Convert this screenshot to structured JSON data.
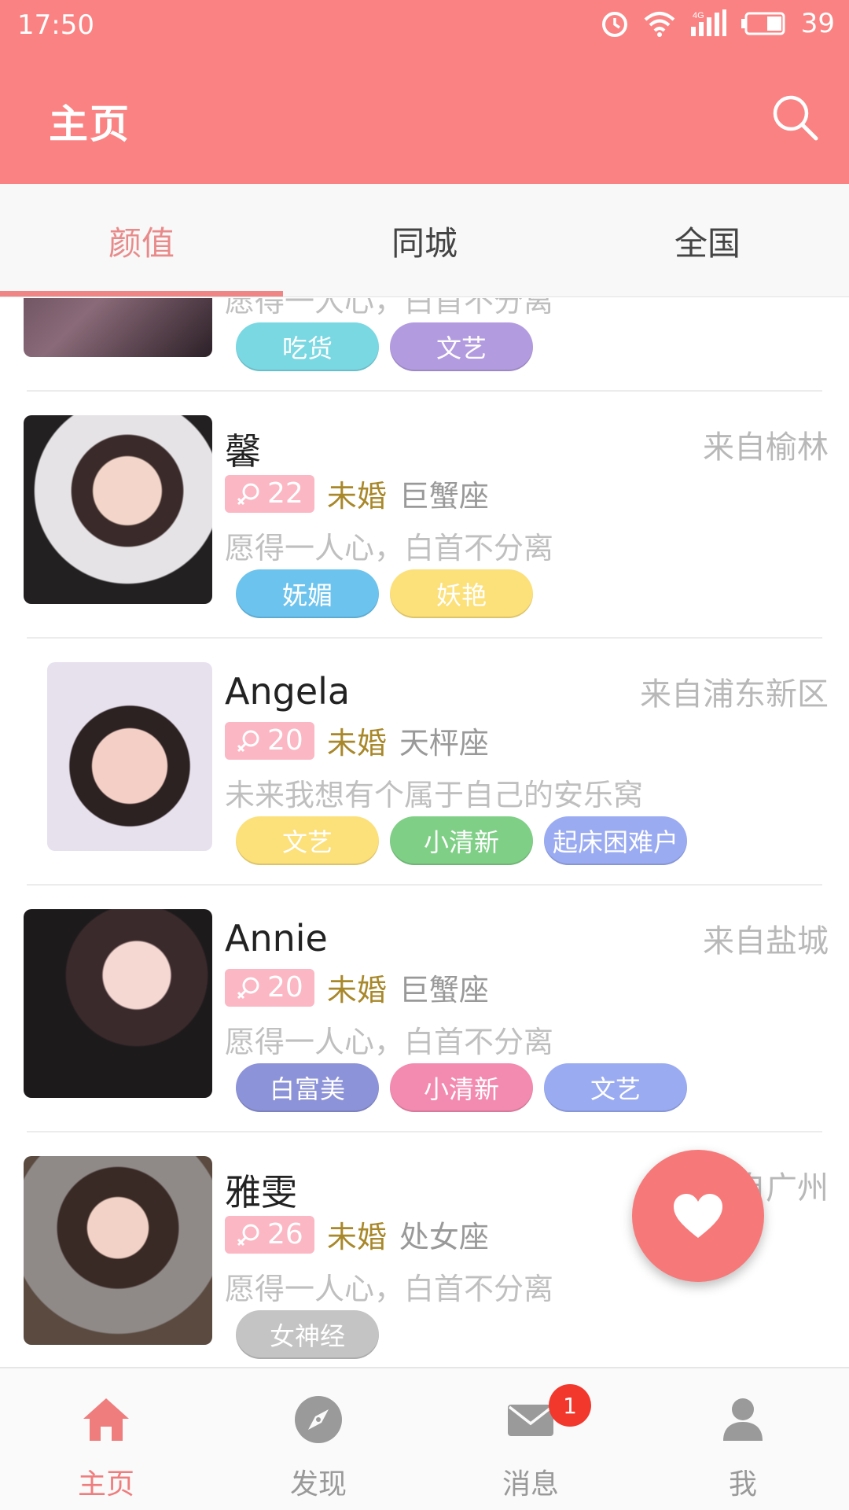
{
  "status_bar": {
    "time": "17:50",
    "network": "4G",
    "battery": "39"
  },
  "app_bar": {
    "title": "主页",
    "search_icon": "search-icon"
  },
  "tabs": [
    {
      "label": "颜值",
      "active": true
    },
    {
      "label": "同城",
      "active": false
    },
    {
      "label": "全国",
      "active": false
    }
  ],
  "profiles": [
    {
      "name": "",
      "from": "",
      "age": "",
      "marital": "",
      "zodiac": "",
      "motto": "愿得一人心，白首不分离",
      "tags": [
        {
          "label": "吃货",
          "color": "#7ad8e3"
        },
        {
          "label": "文艺",
          "color": "#b39be0"
        }
      ]
    },
    {
      "name": "馨",
      "from": "来自榆林",
      "age": "22",
      "marital": "未婚",
      "zodiac": "巨蟹座",
      "motto": "愿得一人心，白首不分离",
      "tags": [
        {
          "label": "妩媚",
          "color": "#6cc3ee"
        },
        {
          "label": "妖艳",
          "color": "#fce07a"
        }
      ]
    },
    {
      "name": "Angela",
      "from": "来自浦东新区",
      "age": "20",
      "marital": "未婚",
      "zodiac": "天枰座",
      "motto": "未来我想有个属于自己的安乐窝",
      "tags": [
        {
          "label": "文艺",
          "color": "#fce07a"
        },
        {
          "label": "小清新",
          "color": "#7fcf86"
        },
        {
          "label": "起床困难户",
          "color": "#9aabf2"
        }
      ]
    },
    {
      "name": "Annie",
      "from": "来自盐城",
      "age": "20",
      "marital": "未婚",
      "zodiac": "巨蟹座",
      "motto": "愿得一人心，白首不分离",
      "tags": [
        {
          "label": "白富美",
          "color": "#8d93d8"
        },
        {
          "label": "小清新",
          "color": "#f38bb0"
        },
        {
          "label": "文艺",
          "color": "#9aabf2"
        }
      ]
    },
    {
      "name": "雅雯",
      "from": "来自广州",
      "age": "26",
      "marital": "未婚",
      "zodiac": "处女座",
      "motto": "愿得一人心，白首不分离",
      "tags": [
        {
          "label": "女神经",
          "color": "#c4c4c4"
        }
      ]
    }
  ],
  "fab": {
    "icon": "heart-icon"
  },
  "bottom_nav": [
    {
      "label": "主页",
      "icon": "home-icon",
      "active": true
    },
    {
      "label": "发现",
      "icon": "compass-icon",
      "active": false
    },
    {
      "label": "消息",
      "icon": "mail-icon",
      "active": false,
      "badge": "1"
    },
    {
      "label": "我",
      "icon": "person-icon",
      "active": false
    }
  ],
  "colors": {
    "primary": "#fb8282",
    "active_tab": "#e98a8a",
    "age_badge": "#fbb7c3",
    "marital": "#a8882a"
  }
}
